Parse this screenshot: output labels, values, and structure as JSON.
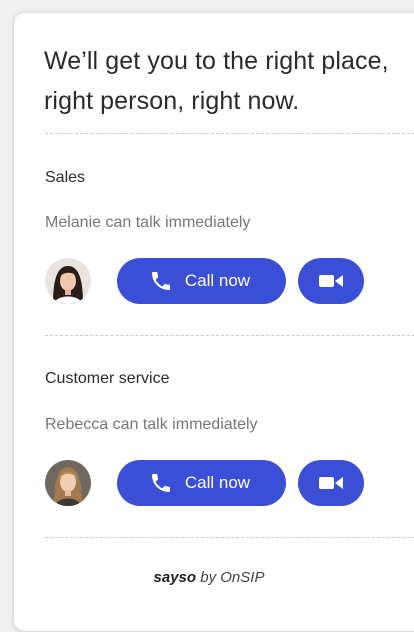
{
  "headline": "We’ll get you to the right place, right person, right now.",
  "departments": [
    {
      "title": "Sales",
      "availability": "Melanie can talk immediately",
      "call_label": "Call now"
    },
    {
      "title": "Customer service",
      "availability": "Rebecca can talk immediately",
      "call_label": "Call now"
    }
  ],
  "footer": {
    "brand": "sayso",
    "by_text": "by OnSIP"
  },
  "colors": {
    "accent": "#3a4ed6",
    "background": "#f1f1f1",
    "card": "#ffffff"
  },
  "icons": {
    "call": "phone-icon",
    "video": "video-camera-icon"
  }
}
